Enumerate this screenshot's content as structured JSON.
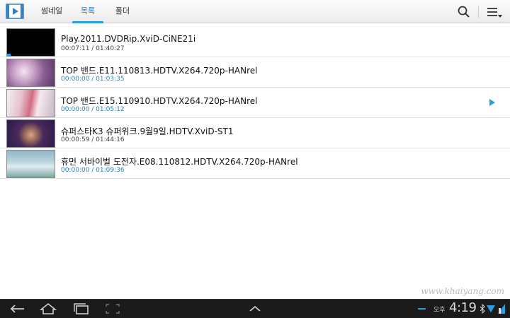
{
  "header": {
    "tabs": [
      {
        "label": "썸네일"
      },
      {
        "label": "목록"
      },
      {
        "label": "폴더"
      }
    ],
    "active_tab_index": 1,
    "accent_color": "#2b9fde"
  },
  "videos": [
    {
      "title": "Play.2011.DVDRip.XviD-CiNE21i",
      "time": "00:07:11 / 01:40:27",
      "watched_fraction": 0.07
    },
    {
      "title": "TOP 밴드.E11.110813.HDTV.X264.720p-HANrel",
      "time": "00:00:00 / 01:03:35",
      "new": true
    },
    {
      "title": "TOP 밴드.E15.110910.HDTV.X264.720p-HANrel",
      "time": "00:00:00 / 01:05:12",
      "new": true,
      "now_playing": true
    },
    {
      "title": "슈퍼스타K3 슈퍼위크.9월9일.HDTV.XviD-ST1",
      "time": "00:00:59 / 01:44:16"
    },
    {
      "title": "휴먼 서바이벌 도전자.E08.110812.HDTV.X264.720p-HANrel",
      "time": "00:00:00 / 01:09:36",
      "new": true
    }
  ],
  "watermark": "www.khaiyang.com",
  "status_bar": {
    "ampm": "오후",
    "time": "4:19"
  }
}
